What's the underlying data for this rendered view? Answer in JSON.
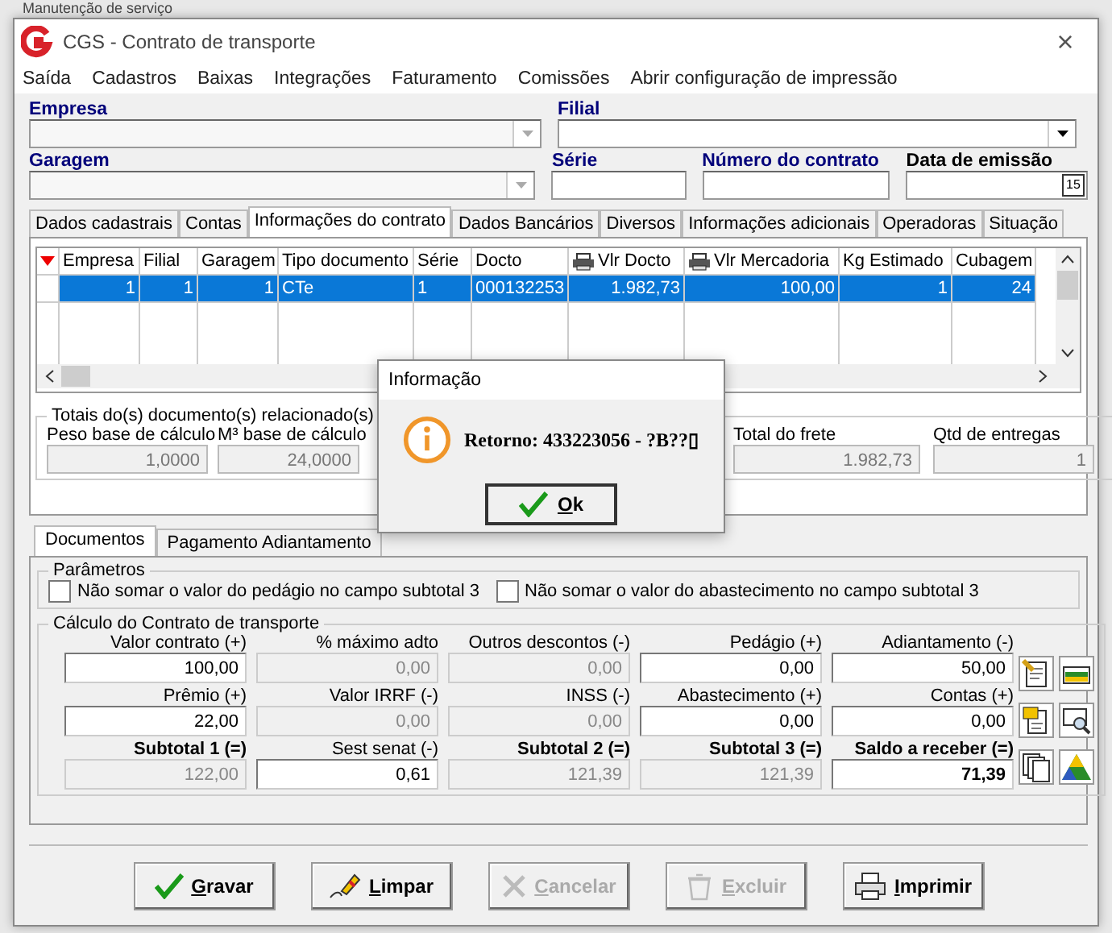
{
  "background": {
    "title": "Manutenção de serviço"
  },
  "window": {
    "title": "CGS - Contrato de transporte",
    "close": "×"
  },
  "menu": [
    "Saída",
    "Cadastros",
    "Baixas",
    "Integrações",
    "Faturamento",
    "Comissões",
    "Abrir configuração de impressão"
  ],
  "header": {
    "empresa": "Empresa",
    "filial": "Filial",
    "garagem": "Garagem",
    "serie": "Série",
    "numero": "Número do contrato",
    "data": "Data de emissão",
    "calendar": "15"
  },
  "tabs": [
    {
      "label": "Dados cadastrais",
      "selected": false
    },
    {
      "label": "Contas",
      "selected": false
    },
    {
      "label": "Informações do contrato",
      "selected": true
    },
    {
      "label": "Dados Bancários",
      "selected": false
    },
    {
      "label": "Diversos",
      "selected": false
    },
    {
      "label": "Informações adicionais",
      "selected": false
    },
    {
      "label": "Operadoras",
      "selected": false
    },
    {
      "label": "Situação",
      "selected": false
    }
  ],
  "grid": {
    "columns": [
      {
        "label": "Empresa",
        "printer": false
      },
      {
        "label": "Filial",
        "printer": false
      },
      {
        "label": "Garagem",
        "printer": false
      },
      {
        "label": "Tipo documento",
        "printer": false
      },
      {
        "label": "Série",
        "printer": false
      },
      {
        "label": "Docto",
        "printer": false
      },
      {
        "label": "Vlr Docto",
        "printer": true
      },
      {
        "label": "Vlr Mercadoria",
        "printer": true
      },
      {
        "label": "Kg Estimado",
        "printer": false
      },
      {
        "label": "Cubagem",
        "printer": false
      }
    ],
    "rows": [
      {
        "selected": true,
        "cells": [
          "1",
          "1",
          "1",
          "CTe",
          "1",
          "000132253",
          "1.982,73",
          "100,00",
          "1",
          "24"
        ]
      }
    ]
  },
  "totals": {
    "title": "Totais do(s) documento(s) relacionado(s)",
    "items": [
      {
        "label": "Peso base de cálculo",
        "value": "1,0000"
      },
      {
        "label": "M³ base de cálculo",
        "value": "24,0000"
      },
      {
        "label": "Total do frete",
        "value": "1.982,73"
      },
      {
        "label": "Qtd de entregas",
        "value": "1"
      }
    ]
  },
  "subtabs": [
    {
      "label": "Documentos",
      "selected": true
    },
    {
      "label": "Pagamento Adiantamento",
      "selected": false
    }
  ],
  "parametros": {
    "title": "Parâmetros",
    "options": [
      {
        "label": "Não somar o valor do pedágio no campo subtotal 3",
        "checked": false
      },
      {
        "label": "Não somar o valor do abastecimento no campo subtotal 3",
        "checked": false
      }
    ]
  },
  "calculo": {
    "title": "Cálculo do Contrato de transporte",
    "fields": [
      {
        "label": "Valor contrato (+)",
        "value": "100,00",
        "readonly": false,
        "bold": false
      },
      {
        "label": "% máximo adto",
        "value": "0,00",
        "readonly": true,
        "bold": false
      },
      {
        "label": "Outros descontos (-)",
        "value": "0,00",
        "readonly": true,
        "bold": false
      },
      {
        "label": "Pedágio (+)",
        "value": "0,00",
        "readonly": false,
        "bold": false
      },
      {
        "label": "Adiantamento (-)",
        "value": "50,00",
        "readonly": false,
        "bold": false
      },
      {
        "label": "Prêmio (+)",
        "value": "22,00",
        "readonly": false,
        "bold": false
      },
      {
        "label": "Valor IRRF (-)",
        "value": "0,00",
        "readonly": true,
        "bold": false
      },
      {
        "label": "INSS (-)",
        "value": "0,00",
        "readonly": true,
        "bold": false
      },
      {
        "label": "Abastecimento (+)",
        "value": "0,00",
        "readonly": false,
        "bold": false
      },
      {
        "label": "Contas (+)",
        "value": "0,00",
        "readonly": false,
        "bold": false
      },
      {
        "label": "Subtotal 1 (=)",
        "value": "122,00",
        "readonly": true,
        "bold": true
      },
      {
        "label": "Sest senat (-)",
        "value": "0,61",
        "readonly": false,
        "bold": false
      },
      {
        "label": "Subtotal 2 (=)",
        "value": "121,39",
        "readonly": true,
        "bold": true
      },
      {
        "label": "Subtotal 3 (=)",
        "value": "121,39",
        "readonly": true,
        "bold": true
      },
      {
        "label": "Saldo a receber (=)",
        "value": "71,39",
        "readonly": false,
        "bold": true
      }
    ]
  },
  "buttons": [
    {
      "kind": "check",
      "label": "Gravar",
      "disabled": false
    },
    {
      "kind": "eraser",
      "label": "Limpar",
      "disabled": false
    },
    {
      "kind": "cross",
      "label": "Cancelar",
      "disabled": true
    },
    {
      "kind": "trash",
      "label": "Excluir",
      "disabled": true
    },
    {
      "kind": "printer",
      "label": "Imprimir",
      "disabled": false
    }
  ],
  "dialog": {
    "title": "Informação",
    "message": "Retorno: 433223056 - ?B??▯",
    "button": "Ok"
  }
}
